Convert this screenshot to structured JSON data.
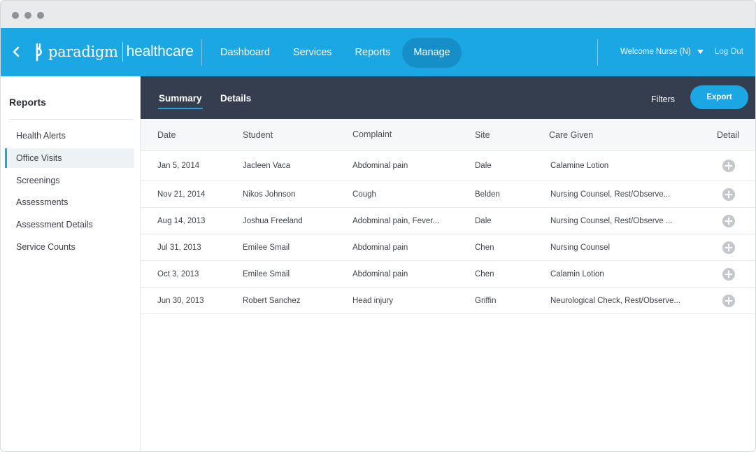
{
  "header": {
    "brand": "paradigm",
    "brand_sub": "healthcare",
    "nav": [
      {
        "label": "Dashboard",
        "active": false
      },
      {
        "label": "Services",
        "active": false
      },
      {
        "label": "Reports",
        "active": false
      },
      {
        "label": "Manage",
        "active": true
      }
    ],
    "welcome": "Welcome Nurse (N)",
    "logout": "Log Out",
    "accent_color": "#1aa7e4"
  },
  "sidebar": {
    "title": "Reports",
    "items": [
      {
        "label": "Health Alerts",
        "active": false
      },
      {
        "label": "Office Visits",
        "active": true
      },
      {
        "label": "Screenings",
        "active": false
      },
      {
        "label": "Assessments",
        "active": false
      },
      {
        "label": "Assessment Details",
        "active": false
      },
      {
        "label": "Service Counts",
        "active": false
      }
    ]
  },
  "toolbar": {
    "tabs": [
      {
        "label": "Summary",
        "active": true
      },
      {
        "label": "Details",
        "active": false
      }
    ],
    "filters": "Filters",
    "export": "Export"
  },
  "table": {
    "columns": [
      "Date",
      "Student",
      "Complaint",
      "Site",
      "Care Given",
      "Detail"
    ],
    "rows": [
      {
        "date": "Jan 5, 2014",
        "student": "Jacleen Vaca",
        "complaint": "Abdominal pain",
        "site": "Dale",
        "care": "Calamine Lotion"
      },
      {
        "date": "Nov 21, 2014",
        "student": "Nikos Johnson",
        "complaint": "Cough",
        "site": "Belden",
        "care": "Nursing Counsel, Rest/Observe..."
      },
      {
        "date": "Aug 14, 2013",
        "student": "Joshua Freeland",
        "complaint": "Adobminal pain, Fever...",
        "site": "Dale",
        "care": "Nursing Counsel, Rest/Observe ..."
      },
      {
        "date": "Jul 31, 2013",
        "student": "Emilee Smail",
        "complaint": "Abdominal pain",
        "site": "Chen",
        "care": "Nursing Counsel"
      },
      {
        "date": "Oct 3, 2013",
        "student": "Emilee Smail",
        "complaint": "Abdominal pain",
        "site": "Chen",
        "care": "Calamin Lotion"
      },
      {
        "date": "Jun 30, 2013",
        "student": "Robert Sanchez",
        "complaint": "Head injury",
        "site": "Griffin",
        "care": "Neurological Check, Rest/Observe..."
      }
    ]
  }
}
